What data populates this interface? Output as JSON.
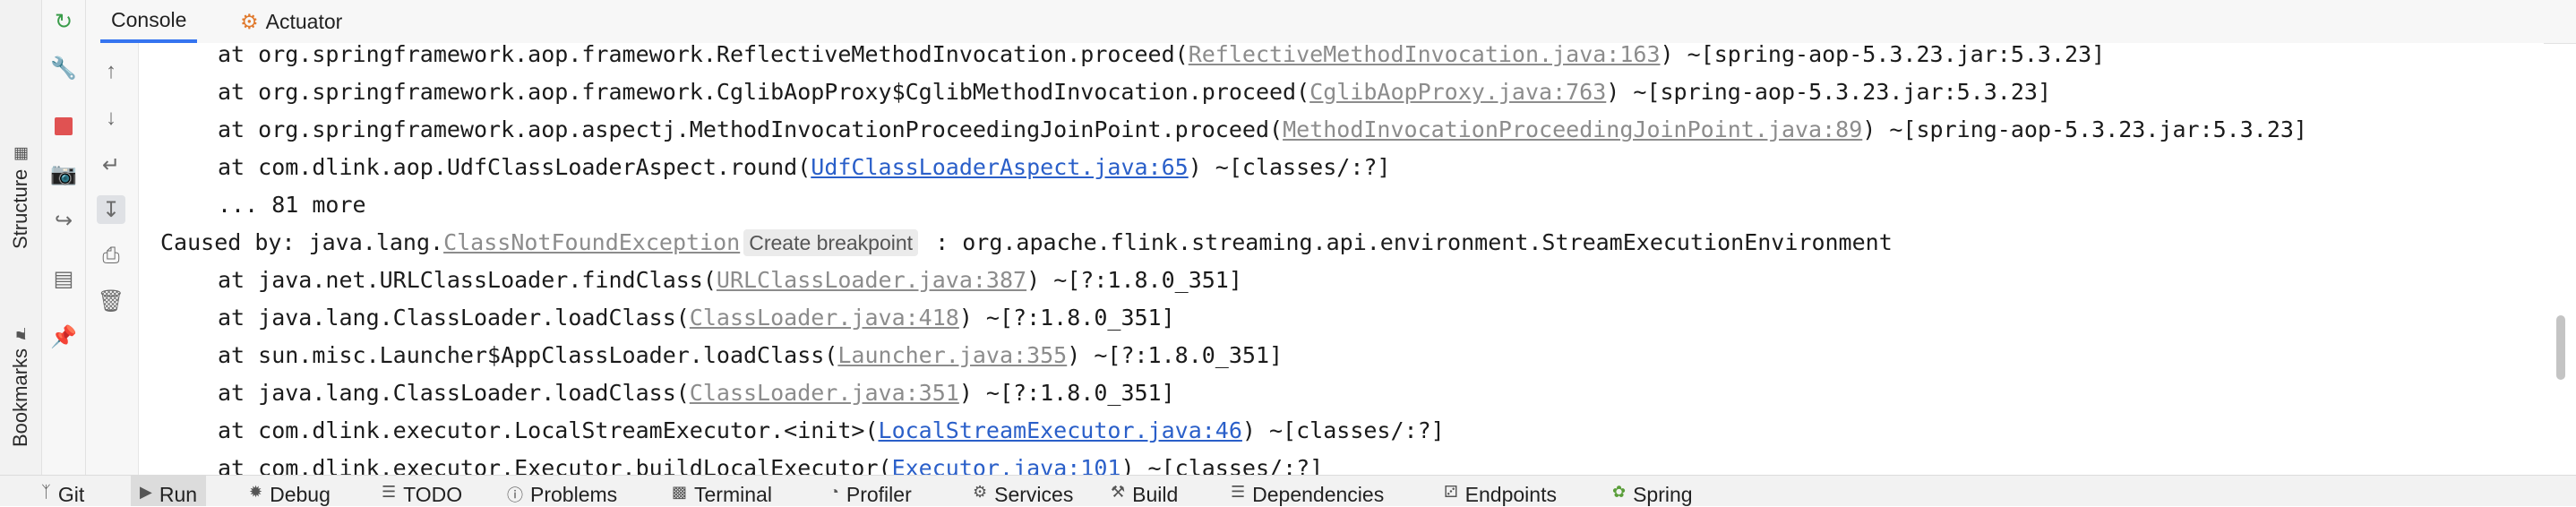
{
  "side_strip": {
    "structure_label": "Structure",
    "bookmarks_label": "Bookmarks"
  },
  "tabs": [
    {
      "label": "Console"
    },
    {
      "label": "Actuator"
    }
  ],
  "console": {
    "lines": [
      {
        "pre": "at org.springframework.aop.framework.ReflectiveMethodInvocation.proceed(",
        "link": "ReflectiveMethodInvocation.java:163",
        "post": ") ~[spring-aop-5.3.23.jar:5.3.23]"
      },
      {
        "pre": "at org.springframework.aop.framework.CglibAopProxy$CglibMethodInvocation.proceed(",
        "link": "CglibAopProxy.java:763",
        "post": ") ~[spring-aop-5.3.23.jar:5.3.23]"
      },
      {
        "pre": "at org.springframework.aop.aspectj.MethodInvocationProceedingJoinPoint.proceed(",
        "link": "MethodInvocationProceedingJoinPoint.java:89",
        "post": ") ~[spring-aop-5.3.23.jar:5.3.23]"
      },
      {
        "pre": "at com.dlink.aop.UdfClassLoaderAspect.round(",
        "link": "UdfClassLoaderAspect.java:65",
        "post": ") ~[classes/:?]"
      },
      {
        "text": "... 81 more"
      },
      {
        "pre": "Caused by: java.lang.",
        "link": "ClassNotFoundException",
        "breakpoint": "Create breakpoint",
        "post": " : org.apache.flink.streaming.api.environment.StreamExecutionEnvironment"
      },
      {
        "pre": "at java.net.URLClassLoader.findClass(",
        "link": "URLClassLoader.java:387",
        "post": ") ~[?:1.8.0_351]"
      },
      {
        "pre": "at java.lang.ClassLoader.loadClass(",
        "link": "ClassLoader.java:418",
        "post": ") ~[?:1.8.0_351]"
      },
      {
        "pre": "at sun.misc.Launcher$AppClassLoader.loadClass(",
        "link": "Launcher.java:355",
        "post": ") ~[?:1.8.0_351]"
      },
      {
        "pre": "at java.lang.ClassLoader.loadClass(",
        "link": "ClassLoader.java:351",
        "post": ") ~[?:1.8.0_351]"
      },
      {
        "pre": "at com.dlink.executor.LocalStreamExecutor.<init>(",
        "link": "LocalStreamExecutor.java:46",
        "post": ") ~[classes/:?]"
      },
      {
        "pre": "at com.dlink.executor.Executor.buildLocalExecutor(",
        "link": "Executor.java:101",
        "post": ") ~[classes/:?]"
      }
    ]
  },
  "bottom_bar": {
    "items": [
      {
        "label": "Git",
        "icon": "git-branch-icon"
      },
      {
        "label": "Run",
        "icon": "play-icon"
      },
      {
        "label": "Debug",
        "icon": "bug-icon"
      },
      {
        "label": "TODO",
        "icon": "list-icon"
      },
      {
        "label": "Problems",
        "icon": "info-icon"
      },
      {
        "label": "Terminal",
        "icon": "terminal-icon"
      },
      {
        "label": "Profiler",
        "icon": "profiler-icon"
      },
      {
        "label": "Services",
        "icon": "gear-icon"
      },
      {
        "label": "Build",
        "icon": "hammer-icon"
      },
      {
        "label": "Dependencies",
        "icon": "layers-icon"
      },
      {
        "label": "Endpoints",
        "icon": "endpoints-icon"
      },
      {
        "label": "Spring",
        "icon": "leaf-icon"
      }
    ]
  },
  "colors": {
    "link_blue": "#2a5fc9",
    "link_grey": "#8c8c8c",
    "stop_red": "#e05252",
    "rerun_green": "#3a9c4a",
    "tab_underline": "#3574f0"
  }
}
